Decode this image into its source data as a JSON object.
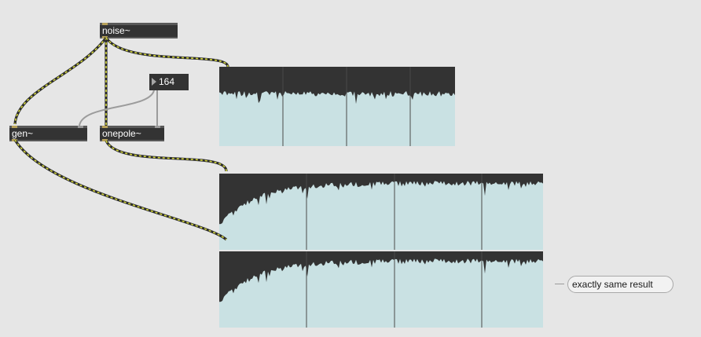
{
  "objects": {
    "noise": {
      "label": "noise~"
    },
    "gen": {
      "label": "gen~"
    },
    "onepole": {
      "label": "onepole~"
    }
  },
  "number_box": {
    "value": "164"
  },
  "comment": {
    "text": "exactly same result"
  },
  "colors": {
    "canvas": "#e6e6e6",
    "object_fill": "#333333",
    "waveform_fill": "#c9e1e3",
    "waveform_background": "#333333",
    "signal_cord": "#d6d93c",
    "control_cord": "#9c9c9c"
  },
  "scopes": {
    "noise_out": {
      "level": 0.34,
      "decay": 0,
      "seed": 11
    },
    "gen_out": {
      "level": 0.13,
      "decay": 0.55,
      "seed": 23
    },
    "onepole_out": {
      "level": 0.13,
      "decay": 0.55,
      "seed": 23
    }
  }
}
